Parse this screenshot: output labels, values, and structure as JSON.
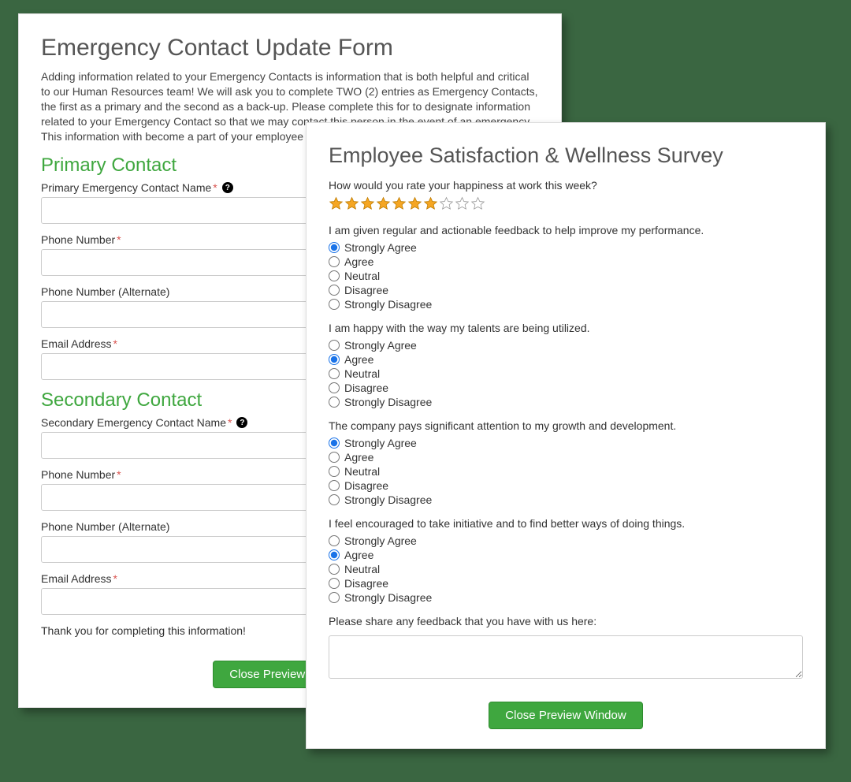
{
  "backForm": {
    "title": "Emergency Contact Update Form",
    "intro": "Adding information related to your Emergency Contacts is information that is both helpful and critical to our Human Resources team! We will ask you to complete TWO (2) entries as Emergency Contacts, the first as a primary and the second as a back-up. Please complete this for to designate information related to your Emergency Contact so that we may contact this person in the event of an emergency. This information with become a part of your employee personnel file.",
    "primaryHeader": "Primary Contact",
    "secondaryHeader": "Secondary Contact",
    "fields": {
      "primaryName": "Primary Emergency Contact Name",
      "phone": "Phone Number",
      "phoneAlt": "Phone Number (Alternate)",
      "email": "Email Address",
      "secondaryName": "Secondary Emergency Contact Name"
    },
    "thankyou": "Thank you for completing this information!",
    "closeLabel": "Close Preview Window"
  },
  "frontForm": {
    "title": "Employee Satisfaction & Wellness Survey",
    "ratingQuestion": "How would you rate your happiness at work this week?",
    "rating": {
      "filled": 7,
      "total": 10
    },
    "likertOptions": [
      "Strongly Agree",
      "Agree",
      "Neutral",
      "Disagree",
      "Strongly Disagree"
    ],
    "questions": [
      {
        "text": "I am given regular and actionable feedback to help improve my performance.",
        "selected": 0
      },
      {
        "text": "I am happy with the way my talents are being utilized.",
        "selected": 1
      },
      {
        "text": "The company pays significant attention to my growth and development.",
        "selected": 0
      },
      {
        "text": "I feel encouraged to take initiative and to find better ways of doing things.",
        "selected": 1
      }
    ],
    "feedbackLabel": "Please share any feedback that you have with us here:",
    "closeLabel": "Close Preview Window"
  }
}
